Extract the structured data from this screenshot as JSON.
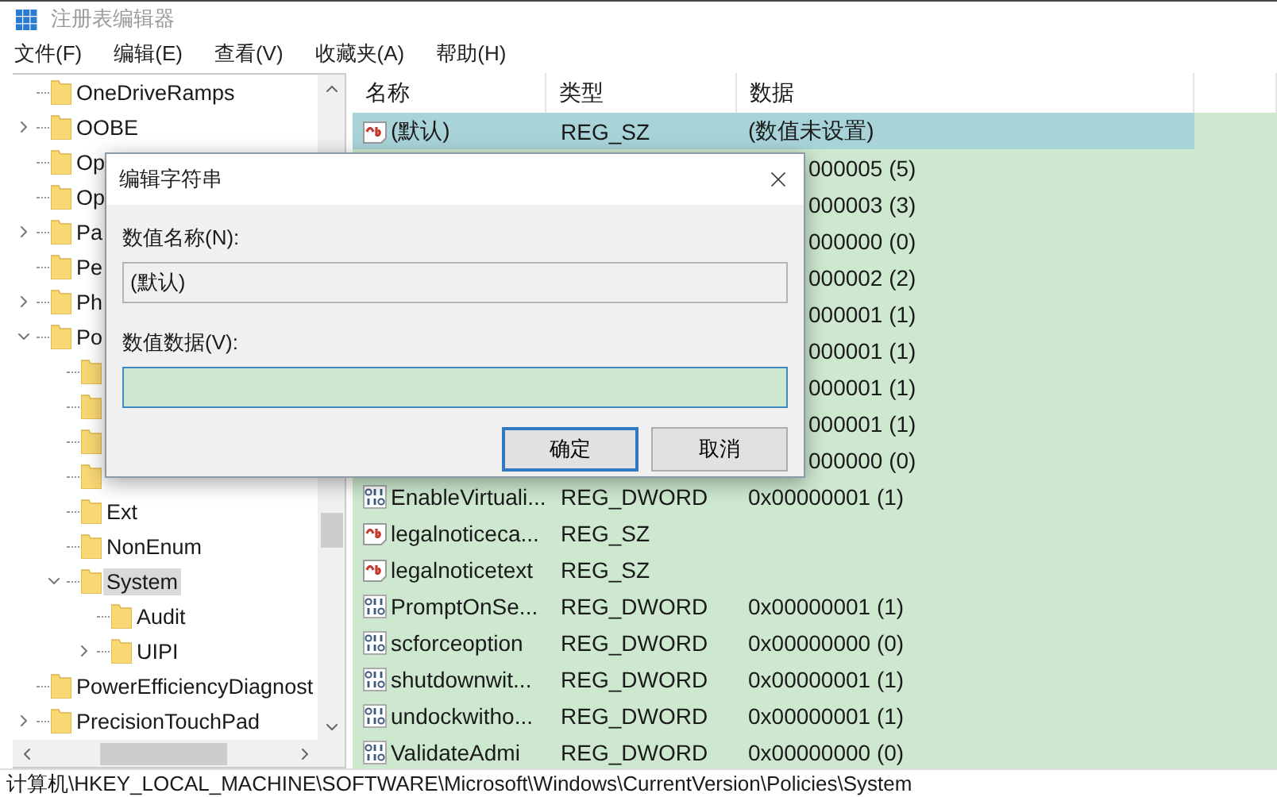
{
  "window": {
    "title": "注册表编辑器"
  },
  "menu": [
    "文件(F)",
    "编辑(E)",
    "查看(V)",
    "收藏夹(A)",
    "帮助(H)"
  ],
  "tree": [
    {
      "label": "OneDriveRamps",
      "selected": false
    },
    {
      "label": "OOBE",
      "expanded": false,
      "selected": false
    },
    {
      "label": "Op",
      "selected": false
    },
    {
      "label": "Op",
      "selected": false
    },
    {
      "label": "Pa",
      "expanded": false,
      "selected": false
    },
    {
      "label": "Pe",
      "selected": false
    },
    {
      "label": "Ph",
      "expanded": false,
      "selected": false
    },
    {
      "label": "Po",
      "expanded": true,
      "selected": false,
      "children": [
        {
          "selected": false
        },
        {
          "selected": false
        },
        {
          "selected": false
        },
        {
          "selected": false
        },
        {
          "label": "Ext",
          "selected": false
        },
        {
          "label": "NonEnum",
          "selected": false
        },
        {
          "label": "System",
          "expanded": true,
          "selected": true,
          "children": [
            {
              "label": "Audit",
              "selected": false
            },
            {
              "label": "UIPI",
              "expanded": false,
              "selected": false
            }
          ]
        }
      ]
    },
    {
      "label": "PowerEfficiencyDiagnost",
      "selected": false
    },
    {
      "label": "PrecisionTouchPad",
      "expanded": false,
      "selected": false
    }
  ],
  "list": {
    "columns": [
      "名称",
      "类型",
      "数据"
    ],
    "rows": [
      {
        "kind": "string",
        "name": "(默认)",
        "type": "REG_SZ",
        "data": "(数值未设置)",
        "selected": true
      },
      {
        "data": "000005 (5)",
        "selected": false
      },
      {
        "data": "000003 (3)",
        "selected": false
      },
      {
        "data": "000000 (0)",
        "selected": false
      },
      {
        "data": "000002 (2)",
        "selected": false
      },
      {
        "data": "000001 (1)",
        "selected": false
      },
      {
        "data": "000001 (1)",
        "selected": false
      },
      {
        "data": "000001 (1)",
        "selected": false
      },
      {
        "data": "000001 (1)",
        "selected": false
      },
      {
        "data": "000000 (0)",
        "selected": false
      },
      {
        "kind": "dword",
        "name": "EnableVirtuali...",
        "type": "REG_DWORD",
        "data": "0x00000001 (1)",
        "selected": false
      },
      {
        "kind": "string",
        "name": "legalnoticeca...",
        "type": "REG_SZ",
        "selected": false
      },
      {
        "kind": "string",
        "name": "legalnoticetext",
        "type": "REG_SZ",
        "selected": false
      },
      {
        "kind": "dword",
        "name": "PromptOnSe...",
        "type": "REG_DWORD",
        "data": "0x00000001 (1)",
        "selected": false
      },
      {
        "kind": "dword",
        "name": "scforceoption",
        "type": "REG_DWORD",
        "data": "0x00000000 (0)",
        "selected": false
      },
      {
        "kind": "dword",
        "name": "shutdownwit...",
        "type": "REG_DWORD",
        "data": "0x00000001 (1)",
        "selected": false
      },
      {
        "kind": "dword",
        "name": "undockwitho...",
        "type": "REG_DWORD",
        "data": "0x00000001 (1)",
        "selected": false
      },
      {
        "kind": "dword",
        "name": "ValidateAdmi",
        "type": "REG_DWORD",
        "data": "0x00000000 (0)",
        "selected": false
      }
    ]
  },
  "dialog": {
    "title": "编辑字符串",
    "name_label": "数值名称(N):",
    "name_value": "(默认)",
    "data_label": "数值数据(V):",
    "buttons": [
      {
        "label": "确定",
        "default": true
      },
      {
        "label": "取消",
        "default": false
      }
    ]
  },
  "status_bar": "计算机\\HKEY_LOCAL_MACHINE\\SOFTWARE\\Microsoft\\Windows\\CurrentVersion\\Policies\\System"
}
